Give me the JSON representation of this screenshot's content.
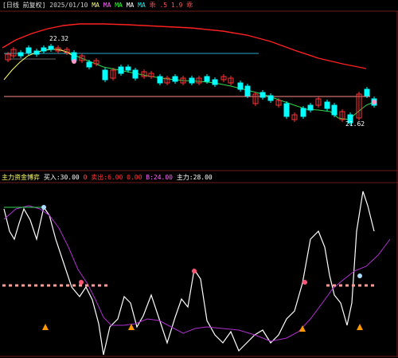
{
  "main_panel": {
    "header": {
      "title": "[日线 前复权]",
      "date": "2025/01/10",
      "ma_labels": [
        "MA",
        "MA",
        "MA",
        "MA",
        "MA"
      ],
      "extra": "乖 .5 1.9 乖",
      "colors": {
        "title": "#e0e0e0",
        "ma1": "#ff66ff",
        "ma2": "#33ff33",
        "ma3": "#ffffff",
        "ma4": "#00ffff",
        "extra": "#ff5555"
      }
    },
    "high_label": "22.32",
    "low_label": "21.62"
  },
  "sub_panel": {
    "header": {
      "name": "主力资金博弈",
      "items": [
        {
          "label": "买入:",
          "value": "30.00",
          "color": "#ffffff"
        },
        {
          "label": "0",
          "value": "",
          "color": "#ff5555"
        },
        {
          "label": "卖出:",
          "value": "6.00",
          "color": "#ff3333"
        },
        {
          "label": "",
          "value": "0.00",
          "color": "#ff3333"
        },
        {
          "label": "B:",
          "value": "24.00",
          "color": "#ff66ff"
        },
        {
          "label": "主力:",
          "value": "28.00",
          "color": "#ffffff"
        }
      ]
    }
  },
  "chart_data": {
    "type": "candlestick",
    "colors": {
      "up": "#ff3333",
      "down": "#00ffff",
      "ma_long": "#ff2020",
      "ma_short": "#2fd84f",
      "ma_fast": "#ffff66"
    },
    "sub_colors": {
      "main_line": "#ffffff",
      "signal_line": "#b030d0",
      "level_line": "#ff9999"
    }
  }
}
